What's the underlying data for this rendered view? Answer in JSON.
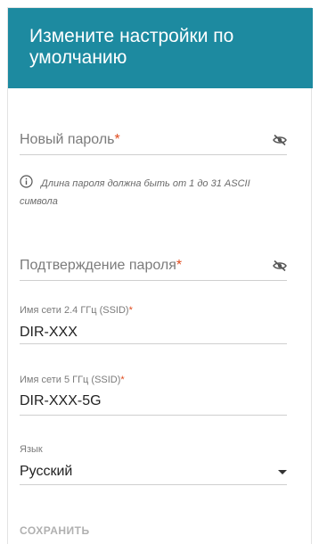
{
  "header": {
    "title": "Измените настройки по умолчанию"
  },
  "new_password": {
    "placeholder": "Новый пароль",
    "required_mark": "*",
    "visibility_icon": "eye-slash-icon"
  },
  "hint": {
    "icon": "info-icon",
    "text": "Длина пароля должна быть от 1 до 31 ASCII символа"
  },
  "confirm_password": {
    "placeholder": "Подтверждение пароля",
    "required_mark": "*",
    "visibility_icon": "eye-slash-icon"
  },
  "ssid_24": {
    "label": "Имя сети 2.4 ГГц (SSID)",
    "required_mark": "*",
    "value": "DIR-XXX"
  },
  "ssid_5": {
    "label": "Имя сети 5 ГГц (SSID)",
    "required_mark": "*",
    "value": "DIR-XXX-5G"
  },
  "language": {
    "label": "Язык",
    "value": "Русский",
    "dropdown_icon": "caret-down-icon"
  },
  "actions": {
    "save_label": "СОХРАНИТЬ"
  },
  "colors": {
    "header_bg": "#1d8aa0",
    "required": "#e04b1e",
    "disabled_text": "#b0b0b0"
  }
}
